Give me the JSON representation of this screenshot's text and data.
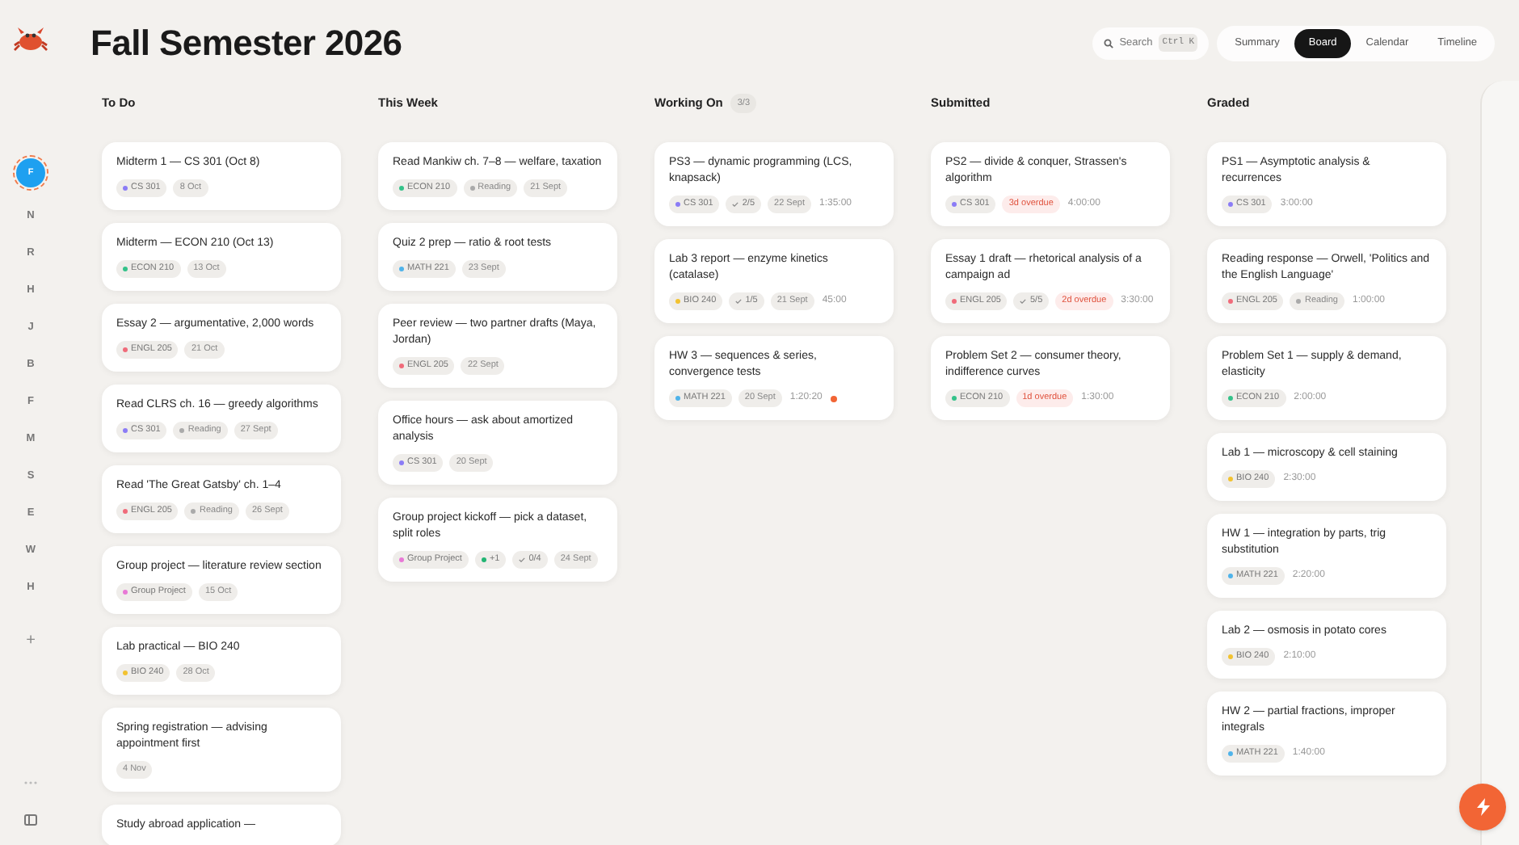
{
  "header": {
    "title": "Fall Semester 2026",
    "search": {
      "placeholder": "Search",
      "shortcut": "Ctrl K"
    },
    "views": [
      {
        "label": "Summary",
        "selected": false
      },
      {
        "label": "Board",
        "selected": true
      },
      {
        "label": "Calendar",
        "selected": false
      },
      {
        "label": "Timeline",
        "selected": false
      }
    ]
  },
  "sidebar": {
    "people": [
      {
        "initial": "F",
        "selected": true
      },
      {
        "initial": "N",
        "selected": false
      },
      {
        "initial": "R",
        "selected": false
      },
      {
        "initial": "H",
        "selected": false
      },
      {
        "initial": "J",
        "selected": false
      },
      {
        "initial": "B",
        "selected": false
      },
      {
        "initial": "F",
        "selected": false
      },
      {
        "initial": "M",
        "selected": false
      },
      {
        "initial": "S",
        "selected": false
      },
      {
        "initial": "E",
        "selected": false
      },
      {
        "initial": "W",
        "selected": false
      },
      {
        "initial": "H",
        "selected": false
      }
    ],
    "add": "+"
  },
  "columns": [
    {
      "title": "To Do",
      "cards": [
        {
          "title": "Midterm 1 — CS 301 (Oct 8)",
          "chips": [
            {
              "kind": "course",
              "text": "CS 301",
              "color": "#8b7cf6"
            },
            {
              "kind": "date",
              "text": "8 Oct"
            }
          ]
        },
        {
          "title": "Midterm — ECON 210 (Oct 13)",
          "chips": [
            {
              "kind": "course",
              "text": "ECON 210",
              "color": "#34c28a"
            },
            {
              "kind": "date",
              "text": "13 Oct"
            }
          ]
        },
        {
          "title": "Essay 2 — argumentative, 2,000 words",
          "chips": [
            {
              "kind": "course",
              "text": "ENGL 205",
              "color": "#f06b7a"
            },
            {
              "kind": "date",
              "text": "21 Oct"
            }
          ]
        },
        {
          "title": "Read CLRS ch. 16 — greedy algorithms",
          "chips": [
            {
              "kind": "course",
              "text": "CS 301",
              "color": "#8b7cf6"
            },
            {
              "kind": "tag",
              "text": "Reading"
            },
            {
              "kind": "date",
              "text": "27 Sept"
            }
          ]
        },
        {
          "title": "Read 'The Great Gatsby' ch. 1–4",
          "chips": [
            {
              "kind": "course",
              "text": "ENGL 205",
              "color": "#f06b7a"
            },
            {
              "kind": "tag",
              "text": "Reading"
            },
            {
              "kind": "date",
              "text": "26 Sept"
            }
          ]
        },
        {
          "title": "Group project — literature review section",
          "chips": [
            {
              "kind": "course",
              "text": "Group Project",
              "color": "#e879d6"
            },
            {
              "kind": "date",
              "text": "15 Oct"
            }
          ]
        },
        {
          "title": "Lab practical — BIO 240",
          "chips": [
            {
              "kind": "course",
              "text": "BIO 240",
              "color": "#f2c230"
            },
            {
              "kind": "date",
              "text": "28 Oct"
            }
          ]
        },
        {
          "title": "Spring registration — advising appointment first",
          "chips": [
            {
              "kind": "date",
              "text": "4 Nov"
            }
          ]
        },
        {
          "title": "Study abroad application —"
        }
      ]
    },
    {
      "title": "This Week",
      "cards": [
        {
          "title": "Read Mankiw ch. 7–8 — welfare, taxation",
          "chips": [
            {
              "kind": "course",
              "text": "ECON 210",
              "color": "#34c28a"
            },
            {
              "kind": "tag",
              "text": "Reading"
            },
            {
              "kind": "date",
              "text": "21 Sept"
            }
          ]
        },
        {
          "title": "Quiz 2 prep — ratio & root tests",
          "chips": [
            {
              "kind": "course",
              "text": "MATH 221",
              "color": "#4fb3ea"
            },
            {
              "kind": "date",
              "text": "23 Sept"
            }
          ]
        },
        {
          "title": "Peer review — two partner drafts (Maya, Jordan)",
          "chips": [
            {
              "kind": "course",
              "text": "ENGL 205",
              "color": "#f06b7a"
            },
            {
              "kind": "date",
              "text": "22 Sept"
            }
          ]
        },
        {
          "title": "Office hours — ask about amortized analysis",
          "chips": [
            {
              "kind": "course",
              "text": "CS 301",
              "color": "#8b7cf6"
            },
            {
              "kind": "date",
              "text": "20 Sept"
            }
          ]
        },
        {
          "title": "Group project kickoff — pick a dataset, split roles",
          "chips": [
            {
              "kind": "course",
              "text": "Group Project",
              "color": "#e879d6"
            },
            {
              "kind": "people",
              "text": "+1",
              "color": "#22b573"
            },
            {
              "kind": "check",
              "text": "0/4"
            },
            {
              "kind": "date",
              "text": "24 Sept"
            }
          ]
        }
      ]
    },
    {
      "title": "Working On",
      "count": "3/3",
      "cards": [
        {
          "title": "PS3 — dynamic programming (LCS, knapsack)",
          "chips": [
            {
              "kind": "course",
              "text": "CS 301",
              "color": "#8b7cf6"
            },
            {
              "kind": "check",
              "text": "2/5"
            },
            {
              "kind": "date",
              "text": "22 Sept"
            },
            {
              "kind": "time",
              "text": "1:35:00"
            }
          ]
        },
        {
          "title": "Lab 3 report — enzyme kinetics (catalase)",
          "chips": [
            {
              "kind": "course",
              "text": "BIO 240",
              "color": "#f2c230"
            },
            {
              "kind": "check",
              "text": "1/5"
            },
            {
              "kind": "date",
              "text": "21 Sept"
            },
            {
              "kind": "time",
              "text": "45:00"
            }
          ]
        },
        {
          "title": "HW 3 — sequences & series, convergence tests",
          "chips": [
            {
              "kind": "course",
              "text": "MATH 221",
              "color": "#4fb3ea"
            },
            {
              "kind": "date",
              "text": "20 Sept"
            },
            {
              "kind": "time",
              "text": "1:20:20"
            },
            {
              "kind": "live"
            }
          ]
        }
      ]
    },
    {
      "title": "Submitted",
      "cards": [
        {
          "title": "PS2 — divide & conquer, Strassen's algorithm",
          "chips": [
            {
              "kind": "course",
              "text": "CS 301",
              "color": "#8b7cf6"
            },
            {
              "kind": "overdue",
              "text": "3d overdue"
            },
            {
              "kind": "time",
              "text": "4:00:00"
            }
          ]
        },
        {
          "title": "Essay 1 draft — rhetorical analysis of a campaign ad",
          "chips": [
            {
              "kind": "course",
              "text": "ENGL 205",
              "color": "#f06b7a"
            },
            {
              "kind": "check",
              "text": "5/5"
            },
            {
              "kind": "overdue",
              "text": "2d overdue"
            },
            {
              "kind": "time",
              "text": "3:30:00"
            }
          ]
        },
        {
          "title": "Problem Set 2 — consumer theory, indifference curves",
          "chips": [
            {
              "kind": "course",
              "text": "ECON 210",
              "color": "#34c28a"
            },
            {
              "kind": "overdue",
              "text": "1d overdue"
            },
            {
              "kind": "time",
              "text": "1:30:00"
            }
          ]
        }
      ]
    },
    {
      "title": "Graded",
      "cards": [
        {
          "title": "PS1 — Asymptotic analysis & recurrences",
          "chips": [
            {
              "kind": "course",
              "text": "CS 301",
              "color": "#8b7cf6"
            },
            {
              "kind": "time",
              "text": "3:00:00"
            }
          ]
        },
        {
          "title": "Reading response — Orwell, 'Politics and the English Language'",
          "chips": [
            {
              "kind": "course",
              "text": "ENGL 205",
              "color": "#f06b7a"
            },
            {
              "kind": "tag",
              "text": "Reading"
            },
            {
              "kind": "time",
              "text": "1:00:00"
            }
          ]
        },
        {
          "title": "Problem Set 1 — supply & demand, elasticity",
          "chips": [
            {
              "kind": "course",
              "text": "ECON 210",
              "color": "#34c28a"
            },
            {
              "kind": "time",
              "text": "2:00:00"
            }
          ]
        },
        {
          "title": "Lab 1 — microscopy & cell staining",
          "chips": [
            {
              "kind": "course",
              "text": "BIO 240",
              "color": "#f2c230"
            },
            {
              "kind": "time",
              "text": "2:30:00"
            }
          ]
        },
        {
          "title": "HW 1 — integration by parts, trig substitution",
          "chips": [
            {
              "kind": "course",
              "text": "MATH 221",
              "color": "#4fb3ea"
            },
            {
              "kind": "time",
              "text": "2:20:00"
            }
          ]
        },
        {
          "title": "Lab 2 — osmosis in potato cores",
          "chips": [
            {
              "kind": "course",
              "text": "BIO 240",
              "color": "#f2c230"
            },
            {
              "kind": "time",
              "text": "2:10:00"
            }
          ]
        },
        {
          "title": "HW 2 — partial fractions, improper integrals",
          "chips": [
            {
              "kind": "course",
              "text": "MATH 221",
              "color": "#4fb3ea"
            },
            {
              "kind": "time",
              "text": "1:40:00"
            }
          ]
        }
      ]
    }
  ]
}
